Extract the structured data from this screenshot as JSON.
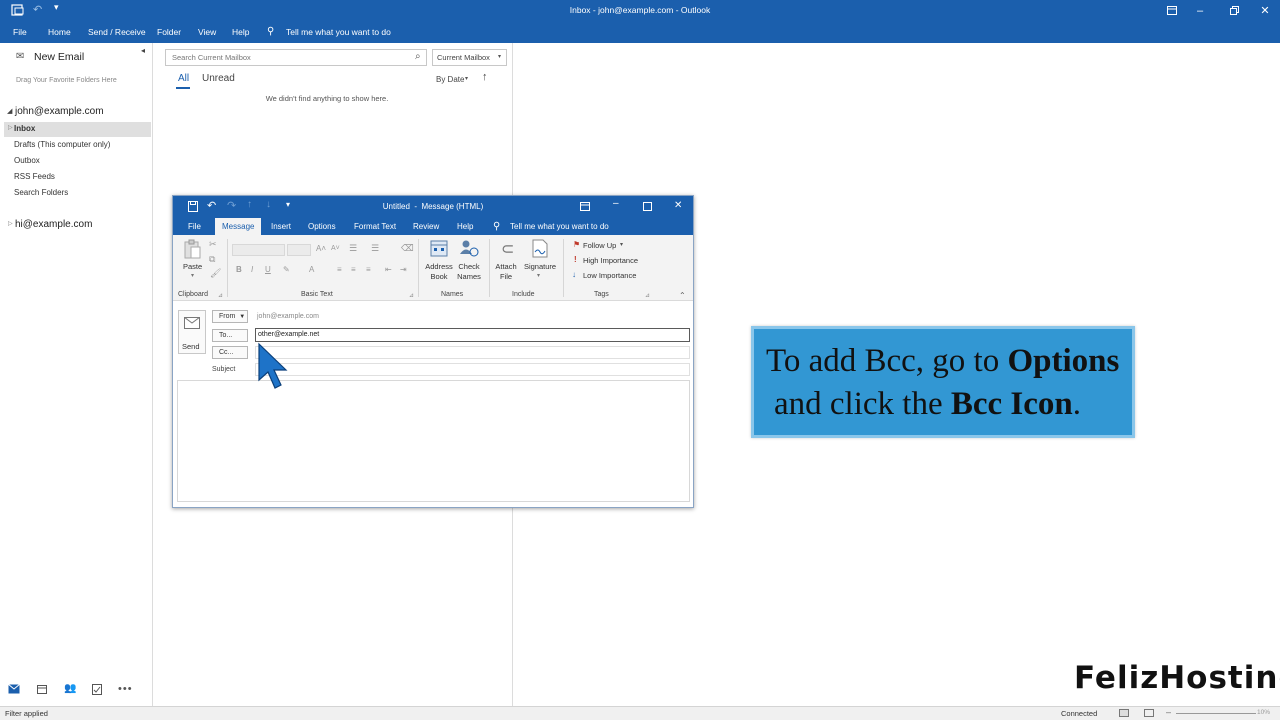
{
  "window": {
    "title": "Inbox - john@example.com - Outlook"
  },
  "menu": {
    "items": [
      "File",
      "Home",
      "Send / Receive",
      "Folder",
      "View",
      "Help"
    ],
    "tell_me": "Tell me what you want to do"
  },
  "sidebar": {
    "new_email": "New Email",
    "favorites_hint": "Drag Your Favorite Folders Here",
    "account1": "john@example.com",
    "folders": [
      "Inbox",
      "Drafts (This computer only)",
      "Outbox",
      "RSS Feeds",
      "Search Folders"
    ],
    "account2": "hi@example.com"
  },
  "list": {
    "search_placeholder": "Search Current Mailbox",
    "scope": "Current Mailbox",
    "tab_all": "All",
    "tab_unread": "Unread",
    "sort": "By Date",
    "empty": "We didn't find anything to show here."
  },
  "compose": {
    "title": "Untitled  -  Message (HTML)",
    "tabs": [
      "File",
      "Message",
      "Insert",
      "Options",
      "Format Text",
      "Review",
      "Help"
    ],
    "active_tab": "Message",
    "tell_me": "Tell me what you want to do",
    "ribbon": {
      "paste": "Paste",
      "clipboard": "Clipboard",
      "basic_text": "Basic Text",
      "address_book_1": "Address",
      "address_book_2": "Book",
      "check_names_1": "Check",
      "check_names_2": "Names",
      "names": "Names",
      "attach_1": "Attach",
      "attach_2": "File",
      "signature": "Signature",
      "include": "Include",
      "follow_up": "Follow Up",
      "high_importance": "High Importance",
      "low_importance": "Low Importance",
      "tags": "Tags"
    },
    "send": "Send",
    "from_label": "From",
    "from_value": "john@example.com",
    "to_label": "To...",
    "to_value": "other@example.net",
    "cc_label": "Cc...",
    "subject_label": "Subject"
  },
  "callout": {
    "line1_prefix": "To add Bcc, go to ",
    "line1_bold": "Options",
    "line2_prefix": "and click the ",
    "line2_bold": "Bcc Icon",
    "line2_suffix": "."
  },
  "brand": {
    "name": "FelizHosting"
  },
  "status": {
    "left": "Filter applied",
    "connection": "Connected",
    "zoom": "10%"
  },
  "colors": {
    "outlook_blue": "#1b5fad",
    "callout_bg": "#3297d3",
    "cursor": "#1e73c8"
  }
}
